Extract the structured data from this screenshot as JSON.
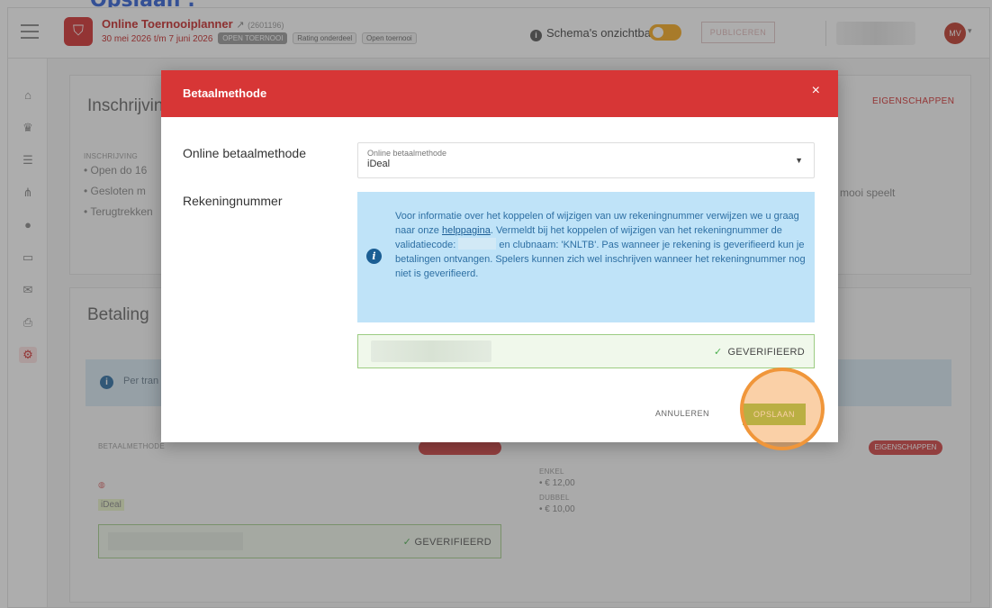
{
  "caption": "Opslaan :",
  "header": {
    "app_title": "Online Toernooiplanner",
    "external_icon": "↗",
    "tournament_id": "(2601196)",
    "date_range": "30 mei 2026 t/m 7 juni 2026",
    "chips": [
      "OPEN TOERNOOI",
      "Rating onderdeel",
      "Open toernooi"
    ],
    "schema_text": "Schema's onzichtbaar",
    "publish_label": "PUBLICEREN",
    "user_initials": "MV"
  },
  "sidebar": {
    "icons": [
      "home-icon",
      "trophy-icon",
      "list-icon",
      "bracket-icon",
      "ball-icon",
      "monitor-icon",
      "mail-icon",
      "print-icon",
      "settings-icon"
    ]
  },
  "background": {
    "inschrijving_title": "Inschrijving",
    "eigenschappen_label": "EIGENSCHAPPEN",
    "inschrijving_label": "INSCHRIJVING",
    "lines": [
      "• Open   do 16",
      "• Gesloten   m",
      "• Terugtrekken"
    ],
    "right_text": "mooi speelt",
    "betaling_title": "Betaling",
    "info_text": "Per tran",
    "betaalmethode_label": "BETAALMETHODE",
    "eigenschappen_pill": "EIGENSCHAPPEN",
    "ideal_label": "iDeal",
    "verified_label": "GEVERIFIEERD",
    "enkel_label": "ENKEL",
    "enkel_price": "• € 12,00",
    "dubbel_label": "DUBBEL",
    "dubbel_price": "• € 10,00"
  },
  "modal": {
    "title": "Betaalmethode",
    "close": "×",
    "online_label": "Online betaalmethode",
    "select_floating_label": "Online betaalmethode",
    "select_value": "iDeal",
    "rekening_label": "Rekeningnummer",
    "info_part1": "Voor informatie over het koppelen of wijzigen van uw rekeningnummer verwijzen we u graag naar onze ",
    "info_link": "helppagina",
    "info_part2": ". Vermeldt bij het koppelen of wijzigen van het rekeningnummer de validatiecode: ",
    "info_part3": " en clubnaam: 'KNLTB'. Pas wanneer je rekening is geverifieerd kun je betalingen ontvangen. Spelers kunnen zich wel inschrijven wanneer het rekeningnummer nog niet is geverifieerd.",
    "verified_label": "GEVERIFIEERD",
    "cancel_label": "ANNULEREN",
    "save_label": "OPSLAAN"
  },
  "colors": {
    "accent": "#d73636",
    "save": "#8bc34a",
    "highlight": "#f0963a",
    "info_bg": "#bfe3f8"
  }
}
